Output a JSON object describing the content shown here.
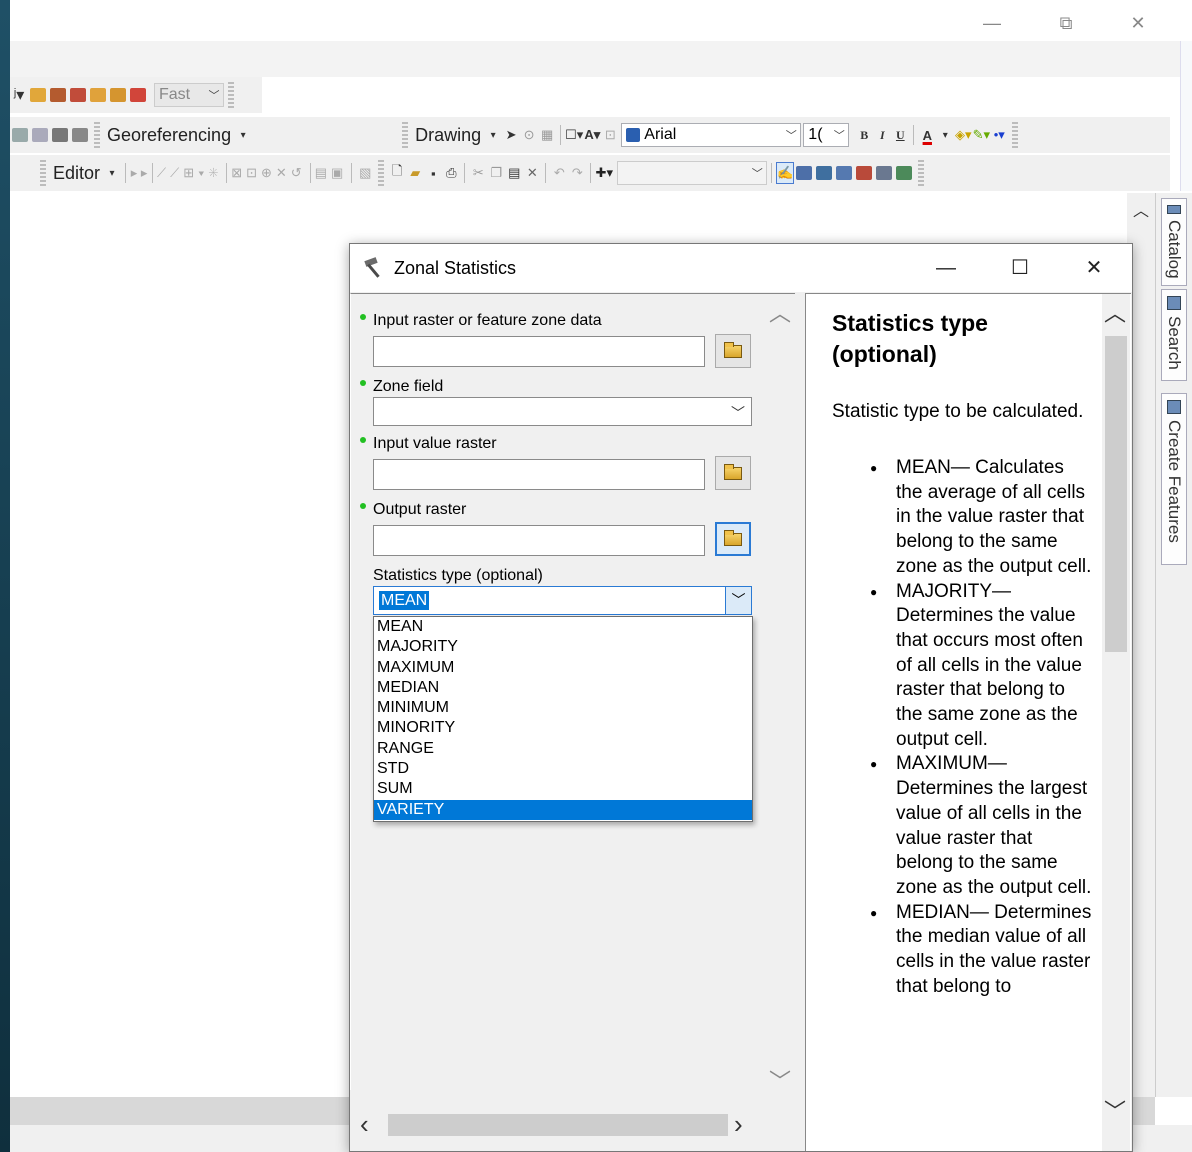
{
  "window": {
    "minimize": "—",
    "restore": "⧉",
    "close": "✕"
  },
  "toolbar1": {
    "fast_label": "Fast"
  },
  "toolbar2": {
    "georeferencing_label": "Georeferencing",
    "drawing_label": "Drawing",
    "font_name": "Arial",
    "font_size": "1(",
    "bold": "B",
    "italic": "I",
    "underline": "U",
    "font_color": "A"
  },
  "toolbar3": {
    "editor_label": "Editor"
  },
  "side_tabs": [
    "Catalog",
    "Search",
    "Create Features"
  ],
  "dialog": {
    "title": "Zonal Statistics",
    "minimize": "—",
    "maximize": "☐",
    "close": "✕",
    "params": {
      "input_zone_label": "Input raster or feature zone data",
      "input_zone_value": "",
      "zone_field_label": "Zone field",
      "zone_field_value": "",
      "input_value_label": "Input value raster",
      "input_value_value": "",
      "output_raster_label": "Output raster",
      "output_raster_value": "",
      "stat_type_label": "Statistics type (optional)",
      "stat_type_value": "MEAN",
      "stat_options": [
        "MEAN",
        "MAJORITY",
        "MAXIMUM",
        "MEDIAN",
        "MINIMUM",
        "MINORITY",
        "RANGE",
        "STD",
        "SUM",
        "VARIETY"
      ],
      "stat_highlighted": "VARIETY"
    },
    "help": {
      "title": "Statistics type (optional)",
      "description": "Statistic type to be calculated.",
      "items": [
        "MEAN— Calculates the average of all cells in the value raster that belong to the same zone as the output cell.",
        "MAJORITY— Determines the value that occurs most often of all cells in the value raster that belong to the same zone as the output cell.",
        "MAXIMUM— Determines the largest value of all cells in the value raster that belong to the same zone as the output cell.",
        "MEDIAN— Determines the median value of all cells in the value raster that belong to"
      ]
    }
  }
}
